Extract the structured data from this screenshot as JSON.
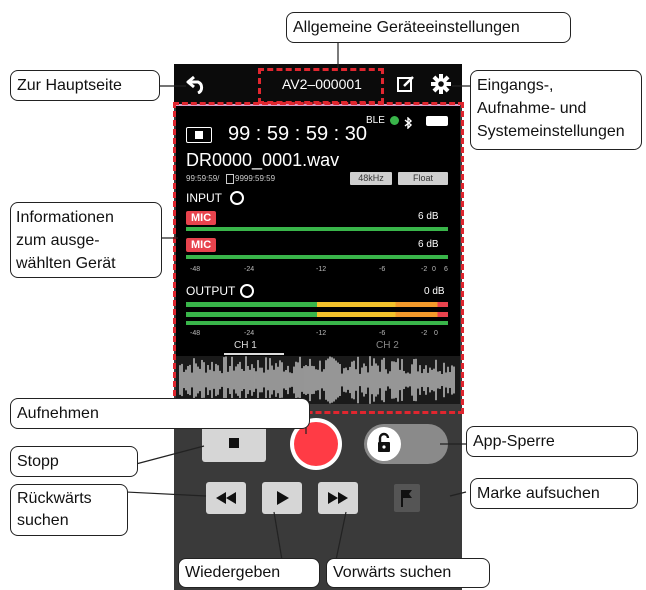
{
  "header": {
    "device_name": "AV2–000001",
    "icons": [
      "back-arrow-icon",
      "edit-icon",
      "gear-icon"
    ]
  },
  "status": {
    "ble": "BLE",
    "timecode": "99 : 59 : 59 : 30",
    "stop_state": "stop-icon"
  },
  "file": {
    "name": "DR0000_0001.wav",
    "remaining": "99:59:59/",
    "counter": "9999:59:59",
    "sample_rate": "48kHz",
    "bit_depth": "Float"
  },
  "input": {
    "label": "INPUT",
    "channels": [
      {
        "tag": "MIC",
        "level": "6 dB"
      },
      {
        "tag": "MIC",
        "level": "6 dB"
      }
    ]
  },
  "scale": [
    "-48",
    "-24",
    "-12",
    "-6",
    "-2",
    "0",
    "6"
  ],
  "output": {
    "label": "OUTPUT",
    "level": "0 dB",
    "scale": [
      "-48",
      "-24",
      "-12",
      "-6",
      "-2",
      "0"
    ]
  },
  "tabs": [
    "CH 1",
    "CH 2"
  ],
  "colors": {
    "accent": "#e8434d",
    "meter_green": "#39b54a",
    "meter_yellow": "#f3c22b",
    "meter_orange": "#f39a2b",
    "dash": "#e0262f"
  },
  "callouts": {
    "home": "Zur Hauptseite",
    "general": "Allgemeine Geräteeinstellungen",
    "input_settings_1": "Eingangs-,",
    "input_settings_2": "Aufnahme- und",
    "input_settings_3": "Systemeinstellungen",
    "info_1": "Informationen",
    "info_2": "zum ausge-",
    "info_3": "wählten Gerät",
    "record": "Aufnehmen",
    "stop": "Stopp",
    "app_lock": "App-Sperre",
    "rewind_1": "Rückwärts",
    "rewind_2": "suchen",
    "marker": "Marke aufsuchen",
    "play": "Wiedergeben",
    "forward": "Vorwärts suchen"
  }
}
